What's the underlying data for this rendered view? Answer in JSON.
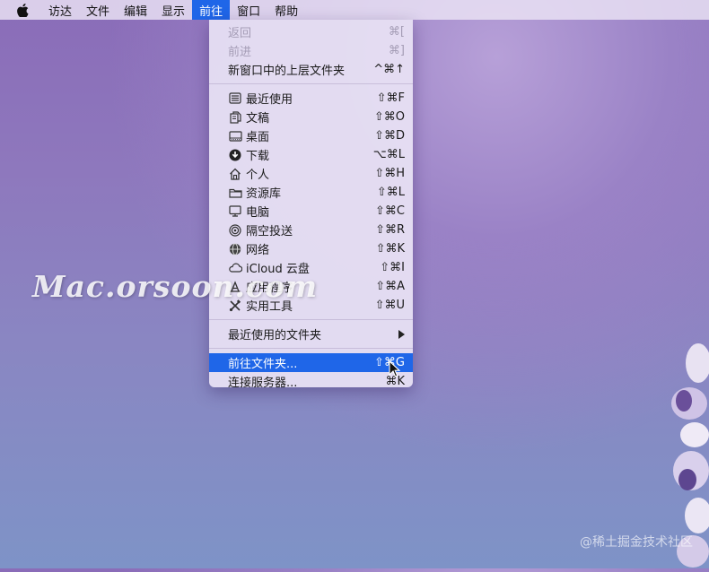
{
  "menubar": {
    "items": [
      "访达",
      "文件",
      "编辑",
      "显示",
      "前往",
      "窗口",
      "帮助"
    ],
    "active_index": 4
  },
  "menu": {
    "group1": [
      {
        "label": "返回",
        "shortcut": "⌘[",
        "disabled": true
      },
      {
        "label": "前进",
        "shortcut": "⌘]",
        "disabled": true
      },
      {
        "label": "新窗口中的上层文件夹",
        "shortcut": "^⌘↑",
        "disabled": false
      }
    ],
    "group2": [
      {
        "label": "最近使用",
        "shortcut": "⇧⌘F",
        "icon": "recents-icon"
      },
      {
        "label": "文稿",
        "shortcut": "⇧⌘O",
        "icon": "documents-icon"
      },
      {
        "label": "桌面",
        "shortcut": "⇧⌘D",
        "icon": "desktop-icon"
      },
      {
        "label": "下载",
        "shortcut": "⌥⌘L",
        "icon": "download-icon"
      },
      {
        "label": "个人",
        "shortcut": "⇧⌘H",
        "icon": "home-icon"
      },
      {
        "label": "资源库",
        "shortcut": "⇧⌘L",
        "icon": "folder-icon"
      },
      {
        "label": "电脑",
        "shortcut": "⇧⌘C",
        "icon": "computer-icon"
      },
      {
        "label": "隔空投送",
        "shortcut": "⇧⌘R",
        "icon": "airdrop-icon"
      },
      {
        "label": "网络",
        "shortcut": "⇧⌘K",
        "icon": "network-icon"
      },
      {
        "label": "iCloud 云盘",
        "shortcut": "⇧⌘I",
        "icon": "cloud-icon"
      },
      {
        "label": "应用程序",
        "shortcut": "⇧⌘A",
        "icon": "applications-icon"
      },
      {
        "label": "实用工具",
        "shortcut": "⇧⌘U",
        "icon": "utilities-icon"
      }
    ],
    "group3": {
      "label": "最近使用的文件夹"
    },
    "group4": [
      {
        "label": "前往文件夹...",
        "shortcut": "⇧⌘G",
        "selected": true
      },
      {
        "label": "连接服务器...",
        "shortcut": "⌘K",
        "selected": false
      }
    ]
  },
  "watermark": "Mac.orsoon.com",
  "credit": "@稀土掘金技术社区",
  "colors": {
    "accent": "#1f66e8"
  }
}
